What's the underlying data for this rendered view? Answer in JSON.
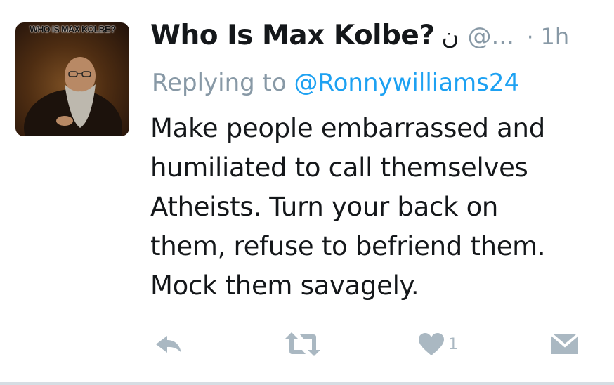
{
  "tweet": {
    "avatar_caption": "WHO IS MAX KOLBE?",
    "display_name": "Who Is Max Kolbe?",
    "name_suffix": "ن",
    "handle": "@...",
    "separator": "·",
    "time": "1h",
    "reply_prefix": "Replying to",
    "reply_user": "@Ronnywilliams24",
    "text": "Make people embarrassed and\nhumiliated to call themselves\nAtheists. Turn your back on\nthem, refuse to befriend them.\nMock them savagely."
  },
  "actions": {
    "reply_icon": "reply-icon",
    "retweet_icon": "retweet-icon",
    "like_icon": "heart-icon",
    "like_count": "1",
    "message_icon": "envelope-icon"
  },
  "colors": {
    "text": "#14171a",
    "muted": "#8899a6",
    "link": "#1da1f2",
    "icon": "#aab8c2"
  }
}
